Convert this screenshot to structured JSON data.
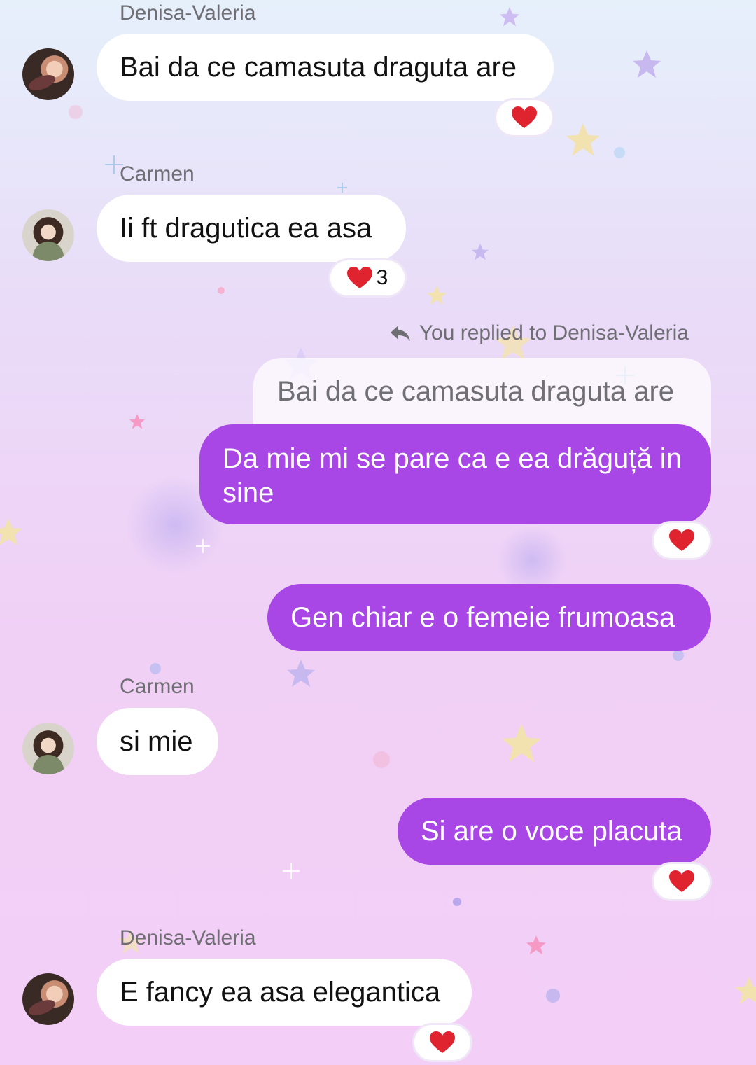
{
  "colors": {
    "outgoing_bubble": "#a846e6",
    "incoming_bubble": "#ffffff",
    "sender_text": "#6e6e73",
    "heart": "#e0242f"
  },
  "messages": [
    {
      "sender": "Denisa-Valeria",
      "text": "Bai da ce camasuta draguta are",
      "reaction": "heart-icon",
      "reaction_count": ""
    },
    {
      "sender": "Carmen",
      "text": "Ii ft dragutica ea asa",
      "reaction": "heart-icon",
      "reaction_count": "3"
    },
    {
      "reply_label": "You replied to Denisa-Valeria",
      "quoted_text": "Bai da ce camasuta draguta are",
      "text": "Da mie mi se pare ca e ea drăguță in sine",
      "reaction": "heart-icon"
    },
    {
      "text": "Gen chiar e o femeie frumoasa"
    },
    {
      "sender": "Carmen",
      "text": "si mie"
    },
    {
      "text": "Si are o voce placuta",
      "reaction": "heart-icon"
    },
    {
      "sender": "Denisa-Valeria",
      "text": "E fancy ea asa elegantica",
      "reaction": "heart-icon"
    }
  ]
}
